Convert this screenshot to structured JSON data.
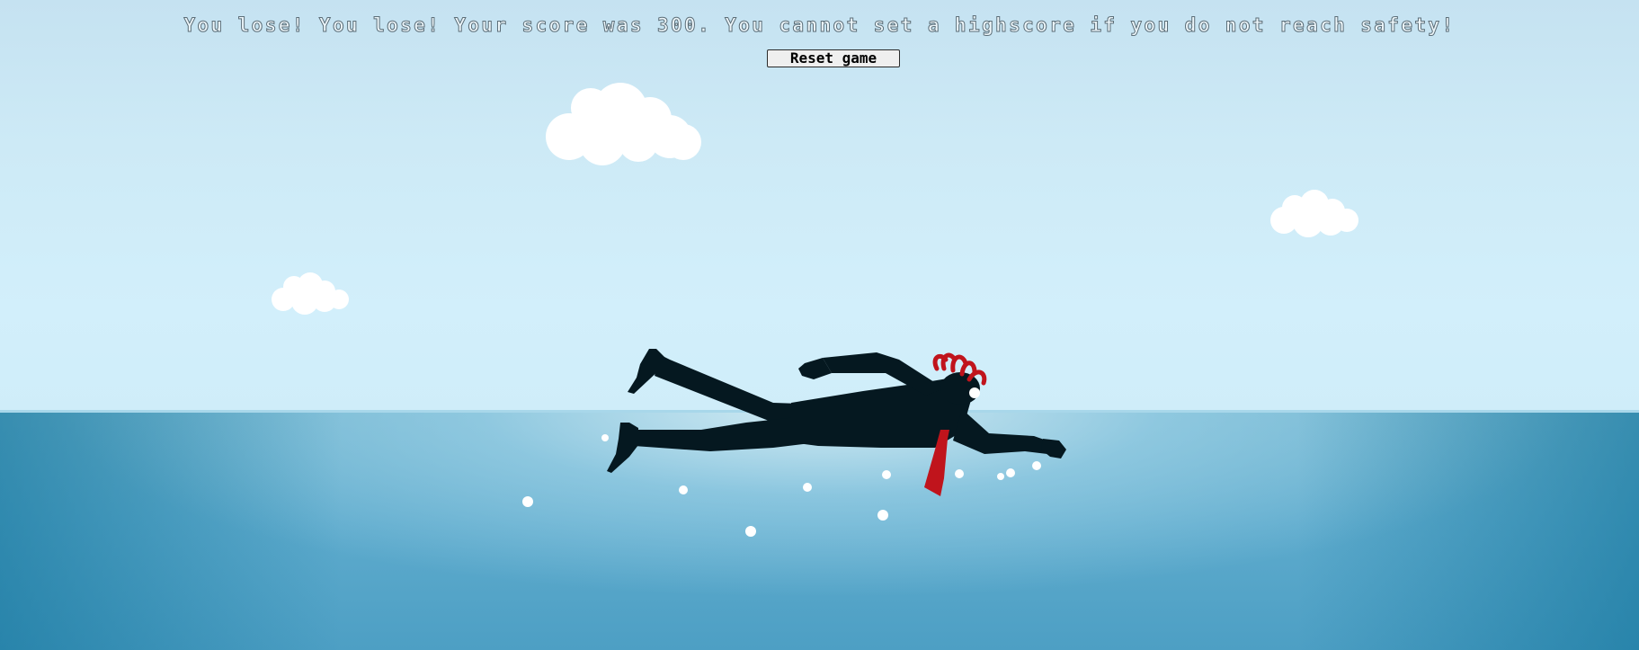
{
  "game": {
    "message": "You lose! You lose! Your score was 300. You cannot set a highscore if you do not reach safety!",
    "reset_label": "Reset game"
  },
  "scene": {
    "sky_color": "#cdeaf6",
    "sea_color": "#5eabcd",
    "figure_color": "#051820",
    "tie_color": "#c0141c",
    "hair_color": "#c0141c"
  }
}
